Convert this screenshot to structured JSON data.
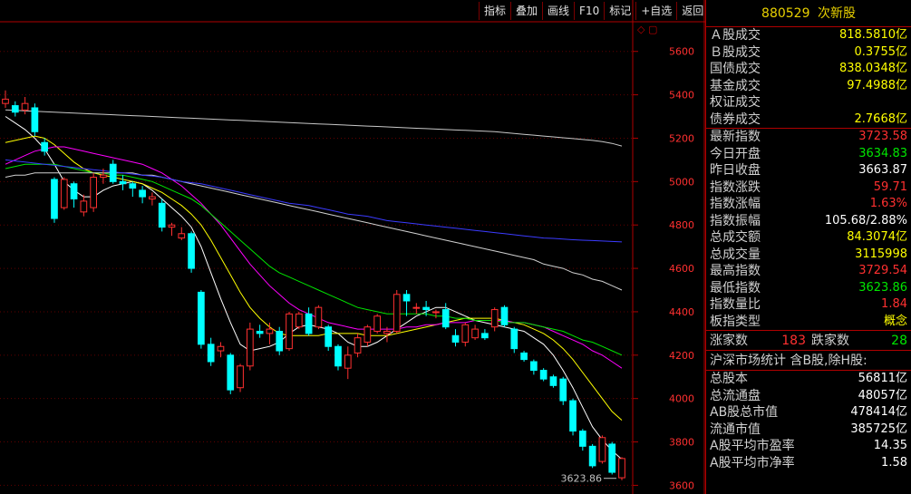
{
  "toolbar": {
    "buttons": [
      "指标",
      "叠加",
      "画线",
      "F10",
      "标记",
      "+自选",
      "返回"
    ]
  },
  "corner_icons": "◇ ▢",
  "colors": {
    "up": "#ff3030",
    "down": "#00ffff",
    "ma5": "#ffffff",
    "ma10": "#ffff00",
    "ma20": "#ff00ff",
    "ma30": "#00e600",
    "ma60": "#d0d0d0",
    "ma120": "#3b3bff",
    "ma250": "#c8c8c8",
    "axis": "#b00000"
  },
  "panel": {
    "code": "880529",
    "name": "次新股",
    "volume_rows": [
      {
        "label": "Ａ股成交",
        "value": "818.5810亿"
      },
      {
        "label": "Ｂ股成交",
        "value": "0.3755亿"
      },
      {
        "label": "国债成交",
        "value": "838.0348亿"
      },
      {
        "label": "基金成交",
        "value": "97.4988亿"
      },
      {
        "label": "权证成交",
        "value": ""
      },
      {
        "label": "债券成交",
        "value": "2.7668亿"
      }
    ],
    "quote_rows": [
      {
        "label": "最新指数",
        "value": "3723.58",
        "color": "red"
      },
      {
        "label": "今日开盘",
        "value": "3634.83",
        "color": "green"
      },
      {
        "label": "昨日收盘",
        "value": "3663.87",
        "color": "white"
      },
      {
        "label": "指数涨跌",
        "value": "59.71",
        "color": "red"
      },
      {
        "label": "指数涨幅",
        "value": "1.63%",
        "color": "red"
      },
      {
        "label": "指数振幅",
        "value": "105.68/2.88%",
        "color": "white"
      },
      {
        "label": "总成交额",
        "value": "84.3074亿",
        "color": "yellow"
      },
      {
        "label": "总成交量",
        "value": "3115998",
        "color": "yellow"
      },
      {
        "label": "最高指数",
        "value": "3729.54",
        "color": "red"
      },
      {
        "label": "最低指数",
        "value": "3623.86",
        "color": "green"
      },
      {
        "label": "指数量比",
        "value": "1.84",
        "color": "red"
      },
      {
        "label": "板指类型",
        "value": "概念",
        "color": "yellow"
      }
    ],
    "rise_label": "涨家数",
    "rise_value": "183",
    "fall_label": "跌家数",
    "fall_value": "28",
    "market_title": "沪深市场统计 含B股,除H股:",
    "market_rows": [
      {
        "label": "总股本",
        "value": "56811亿"
      },
      {
        "label": "总流通盘",
        "value": "48057亿"
      },
      {
        "label": "AB股总市值",
        "value": "478414亿"
      },
      {
        "label": "流通市值",
        "value": "385725亿"
      },
      {
        "label": "A股平均市盈率",
        "value": "14.35"
      },
      {
        "label": "A股平均市净率",
        "value": "1.58"
      }
    ]
  },
  "chart_data": {
    "type": "candlestick",
    "y_ticks": [
      3600,
      3800,
      4000,
      4200,
      4400,
      4600,
      4800,
      5000,
      5200,
      5400,
      5600
    ],
    "ylim": [
      3560,
      5720
    ],
    "low_label": "3623.86",
    "candles": [
      {
        "o": 5360,
        "c": 5380,
        "h": 5420,
        "l": 5340
      },
      {
        "o": 5350,
        "c": 5320,
        "h": 5370,
        "l": 5300
      },
      {
        "o": 5330,
        "c": 5360,
        "h": 5390,
        "l": 5310
      },
      {
        "o": 5340,
        "c": 5230,
        "h": 5360,
        "l": 5210
      },
      {
        "o": 5180,
        "c": 5140,
        "h": 5200,
        "l": 5120
      },
      {
        "o": 5010,
        "c": 4830,
        "h": 5020,
        "l": 4810
      },
      {
        "o": 4880,
        "c": 5010,
        "h": 5020,
        "l": 4870
      },
      {
        "o": 4990,
        "c": 4920,
        "h": 5000,
        "l": 4880
      },
      {
        "o": 4860,
        "c": 4910,
        "h": 4940,
        "l": 4840
      },
      {
        "o": 4880,
        "c": 5020,
        "h": 5040,
        "l": 4860
      },
      {
        "o": 5020,
        "c": 5030,
        "h": 5060,
        "l": 4990
      },
      {
        "o": 5080,
        "c": 5000,
        "h": 5100,
        "l": 4990
      },
      {
        "o": 5000,
        "c": 4990,
        "h": 5030,
        "l": 4960
      },
      {
        "o": 4990,
        "c": 4970,
        "h": 5000,
        "l": 4930
      },
      {
        "o": 4960,
        "c": 4930,
        "h": 4980,
        "l": 4900
      },
      {
        "o": 4920,
        "c": 4930,
        "h": 4950,
        "l": 4890
      },
      {
        "o": 4900,
        "c": 4790,
        "h": 4920,
        "l": 4770
      },
      {
        "o": 4790,
        "c": 4800,
        "h": 4810,
        "l": 4750
      },
      {
        "o": 4740,
        "c": 4760,
        "h": 4790,
        "l": 4730
      },
      {
        "o": 4760,
        "c": 4600,
        "h": 4770,
        "l": 4580
      },
      {
        "o": 4490,
        "c": 4250,
        "h": 4500,
        "l": 4230
      },
      {
        "o": 4250,
        "c": 4170,
        "h": 4280,
        "l": 4150
      },
      {
        "o": 4220,
        "c": 4240,
        "h": 4260,
        "l": 4190
      },
      {
        "o": 4200,
        "c": 4040,
        "h": 4210,
        "l": 4020
      },
      {
        "o": 4050,
        "c": 4150,
        "h": 4160,
        "l": 4030
      },
      {
        "o": 4150,
        "c": 4320,
        "h": 4350,
        "l": 4130
      },
      {
        "o": 4310,
        "c": 4300,
        "h": 4340,
        "l": 4280
      },
      {
        "o": 4300,
        "c": 4320,
        "h": 4350,
        "l": 4250
      },
      {
        "o": 4310,
        "c": 4220,
        "h": 4330,
        "l": 4200
      },
      {
        "o": 4230,
        "c": 4390,
        "h": 4400,
        "l": 4220
      },
      {
        "o": 4330,
        "c": 4390,
        "h": 4400,
        "l": 4320
      },
      {
        "o": 4390,
        "c": 4300,
        "h": 4420,
        "l": 4290
      },
      {
        "o": 4330,
        "c": 4420,
        "h": 4430,
        "l": 4320
      },
      {
        "o": 4330,
        "c": 4240,
        "h": 4340,
        "l": 4220
      },
      {
        "o": 4240,
        "c": 4150,
        "h": 4250,
        "l": 4130
      },
      {
        "o": 4140,
        "c": 4200,
        "h": 4240,
        "l": 4090
      },
      {
        "o": 4210,
        "c": 4280,
        "h": 4300,
        "l": 4190
      },
      {
        "o": 4260,
        "c": 4330,
        "h": 4340,
        "l": 4240
      },
      {
        "o": 4310,
        "c": 4380,
        "h": 4390,
        "l": 4300
      },
      {
        "o": 4300,
        "c": 4310,
        "h": 4330,
        "l": 4260
      },
      {
        "o": 4310,
        "c": 4480,
        "h": 4500,
        "l": 4300
      },
      {
        "o": 4480,
        "c": 4450,
        "h": 4500,
        "l": 4380
      },
      {
        "o": 4420,
        "c": 4420,
        "h": 4440,
        "l": 4390
      },
      {
        "o": 4420,
        "c": 4410,
        "h": 4450,
        "l": 4380
      },
      {
        "o": 4400,
        "c": 4400,
        "h": 4410,
        "l": 4370
      },
      {
        "o": 4410,
        "c": 4330,
        "h": 4440,
        "l": 4320
      },
      {
        "o": 4290,
        "c": 4260,
        "h": 4320,
        "l": 4240
      },
      {
        "o": 4260,
        "c": 4340,
        "h": 4350,
        "l": 4240
      },
      {
        "o": 4280,
        "c": 4320,
        "h": 4340,
        "l": 4270
      },
      {
        "o": 4300,
        "c": 4280,
        "h": 4320,
        "l": 4270
      },
      {
        "o": 4330,
        "c": 4410,
        "h": 4420,
        "l": 4310
      },
      {
        "o": 4420,
        "c": 4340,
        "h": 4430,
        "l": 4330
      },
      {
        "o": 4320,
        "c": 4230,
        "h": 4330,
        "l": 4210
      },
      {
        "o": 4210,
        "c": 4180,
        "h": 4220,
        "l": 4170
      },
      {
        "o": 4170,
        "c": 4130,
        "h": 4180,
        "l": 4110
      },
      {
        "o": 4130,
        "c": 4090,
        "h": 4140,
        "l": 4080
      },
      {
        "o": 4100,
        "c": 4060,
        "h": 4110,
        "l": 4050
      },
      {
        "o": 4090,
        "c": 3990,
        "h": 4100,
        "l": 3970
      },
      {
        "o": 3990,
        "c": 3850,
        "h": 4000,
        "l": 3830
      },
      {
        "o": 3850,
        "c": 3780,
        "h": 3860,
        "l": 3760
      },
      {
        "o": 3780,
        "c": 3690,
        "h": 3790,
        "l": 3680
      },
      {
        "o": 3710,
        "c": 3820,
        "h": 3830,
        "l": 3700
      },
      {
        "o": 3790,
        "c": 3660,
        "h": 3800,
        "l": 3650
      },
      {
        "o": 3634.83,
        "c": 3723.58,
        "h": 3729.54,
        "l": 3623.86
      }
    ],
    "series": [
      {
        "name": "MA5",
        "values": [
          5300,
          5270,
          5240,
          5200,
          5150,
          5080,
          5000,
          4960,
          4930,
          4930,
          4960,
          4980,
          4990,
          5000,
          4990,
          4960,
          4920,
          4880,
          4840,
          4790,
          4700,
          4580,
          4460,
          4350,
          4250,
          4220,
          4230,
          4240,
          4260,
          4300,
          4330,
          4340,
          4330,
          4320,
          4300,
          4260,
          4240,
          4240,
          4260,
          4290,
          4320,
          4350,
          4380,
          4400,
          4420,
          4420,
          4400,
          4380,
          4360,
          4350,
          4340,
          4330,
          4320,
          4310,
          4280,
          4250,
          4200,
          4130,
          4050,
          3960,
          3870,
          3810,
          3760,
          3720
        ]
      },
      {
        "name": "MA10",
        "values": [
          5180,
          5190,
          5200,
          5210,
          5200,
          5170,
          5130,
          5090,
          5060,
          5040,
          5030,
          5020,
          5010,
          5000,
          4990,
          4970,
          4950,
          4920,
          4890,
          4850,
          4800,
          4730,
          4650,
          4570,
          4490,
          4420,
          4370,
          4330,
          4300,
          4290,
          4290,
          4290,
          4290,
          4300,
          4300,
          4300,
          4300,
          4290,
          4290,
          4290,
          4300,
          4310,
          4320,
          4330,
          4340,
          4350,
          4360,
          4370,
          4370,
          4370,
          4370,
          4360,
          4350,
          4340,
          4320,
          4300,
          4270,
          4230,
          4180,
          4120,
          4060,
          4000,
          3940,
          3900
        ]
      },
      {
        "name": "MA20",
        "values": [
          5080,
          5100,
          5120,
          5140,
          5150,
          5160,
          5160,
          5150,
          5140,
          5130,
          5120,
          5110,
          5100,
          5090,
          5080,
          5060,
          5040,
          5010,
          4980,
          4940,
          4900,
          4850,
          4800,
          4740,
          4680,
          4620,
          4570,
          4520,
          4480,
          4440,
          4410,
          4390,
          4370,
          4350,
          4340,
          4330,
          4320,
          4320,
          4320,
          4320,
          4320,
          4330,
          4330,
          4340,
          4340,
          4350,
          4350,
          4350,
          4360,
          4360,
          4360,
          4360,
          4350,
          4350,
          4340,
          4330,
          4310,
          4290,
          4270,
          4250,
          4220,
          4200,
          4170,
          4140
        ]
      },
      {
        "name": "MA30",
        "values": [
          5060,
          5070,
          5080,
          5080,
          5080,
          5080,
          5070,
          5060,
          5050,
          5040,
          5040,
          5030,
          5030,
          5020,
          5010,
          5000,
          4980,
          4960,
          4940,
          4920,
          4890,
          4850,
          4810,
          4770,
          4730,
          4690,
          4650,
          4610,
          4580,
          4560,
          4540,
          4520,
          4500,
          4480,
          4460,
          4440,
          4420,
          4410,
          4400,
          4390,
          4390,
          4390,
          4390,
          4390,
          4380,
          4380,
          4370,
          4370,
          4360,
          4360,
          4360,
          4350,
          4350,
          4350,
          4340,
          4330,
          4320,
          4310,
          4290,
          4270,
          4260,
          4240,
          4220,
          4200
        ]
      },
      {
        "name": "MA60",
        "values": [
          5020,
          5030,
          5030,
          5040,
          5040,
          5040,
          5040,
          5040,
          5040,
          5040,
          5040,
          5040,
          5040,
          5040,
          5030,
          5030,
          5020,
          5010,
          5000,
          4990,
          4980,
          4970,
          4960,
          4950,
          4940,
          4930,
          4920,
          4910,
          4900,
          4890,
          4880,
          4870,
          4860,
          4850,
          4840,
          4830,
          4820,
          4810,
          4800,
          4790,
          4780,
          4770,
          4760,
          4750,
          4740,
          4730,
          4720,
          4710,
          4700,
          4690,
          4680,
          4670,
          4660,
          4650,
          4640,
          4620,
          4610,
          4600,
          4580,
          4570,
          4550,
          4540,
          4520,
          4500
        ]
      },
      {
        "name": "MA120",
        "values": [
          5100,
          5095,
          5090,
          5085,
          5080,
          5075,
          5070,
          5065,
          5060,
          5055,
          5050,
          5045,
          5040,
          5035,
          5030,
          5025,
          5020,
          5010,
          5000,
          4995,
          4990,
          4980,
          4970,
          4960,
          4950,
          4940,
          4930,
          4920,
          4910,
          4900,
          4895,
          4890,
          4880,
          4870,
          4860,
          4850,
          4845,
          4840,
          4830,
          4820,
          4815,
          4810,
          4805,
          4800,
          4795,
          4790,
          4785,
          4780,
          4775,
          4770,
          4765,
          4760,
          4755,
          4750,
          4745,
          4740,
          4738,
          4735,
          4732,
          4730,
          4728,
          4726,
          4724,
          4722
        ]
      },
      {
        "name": "MA250",
        "values": [
          5330,
          5328,
          5326,
          5324,
          5322,
          5320,
          5318,
          5316,
          5314,
          5312,
          5310,
          5308,
          5306,
          5304,
          5302,
          5300,
          5298,
          5296,
          5294,
          5292,
          5290,
          5288,
          5286,
          5284,
          5282,
          5280,
          5278,
          5276,
          5274,
          5272,
          5270,
          5268,
          5266,
          5264,
          5262,
          5260,
          5258,
          5256,
          5254,
          5252,
          5250,
          5248,
          5246,
          5244,
          5242,
          5240,
          5238,
          5236,
          5234,
          5232,
          5230,
          5226,
          5222,
          5218,
          5214,
          5210,
          5206,
          5202,
          5198,
          5194,
          5190,
          5184,
          5176,
          5164
        ]
      }
    ]
  }
}
